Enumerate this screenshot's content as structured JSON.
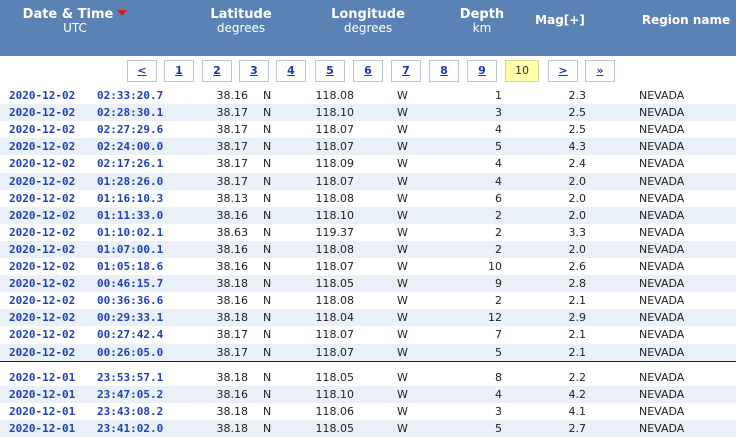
{
  "header": {
    "date_time": "Date & Time",
    "utc": "UTC",
    "latitude": "Latitude",
    "lat_unit": "degrees",
    "longitude": "Longitude",
    "lon_unit": "degrees",
    "depth": "Depth",
    "depth_unit": "km",
    "mag": "Mag[+]",
    "region": "Region name",
    "colors": {
      "header_bg": "#5b82b5",
      "sort_arrow": "#d21c24",
      "link": "#1f3fbf",
      "alt_row": "#e9f0f8",
      "current_page": "#ffffaa"
    }
  },
  "pager": {
    "prev": "<",
    "next": ">",
    "last": "»",
    "pages": [
      "1",
      "2",
      "3",
      "4",
      "5",
      "6",
      "7",
      "8",
      "9",
      "10"
    ],
    "current": "10"
  },
  "rows": [
    {
      "date": "2020-12-02",
      "time": "02:33:20.7",
      "lat": "38.16",
      "ns": "N",
      "lon": "118.08",
      "ew": "W",
      "depth": "1",
      "mag": "2.3",
      "region": "NEVADA"
    },
    {
      "date": "2020-12-02",
      "time": "02:28:30.1",
      "lat": "38.17",
      "ns": "N",
      "lon": "118.10",
      "ew": "W",
      "depth": "3",
      "mag": "2.5",
      "region": "NEVADA"
    },
    {
      "date": "2020-12-02",
      "time": "02:27:29.6",
      "lat": "38.17",
      "ns": "N",
      "lon": "118.07",
      "ew": "W",
      "depth": "4",
      "mag": "2.5",
      "region": "NEVADA"
    },
    {
      "date": "2020-12-02",
      "time": "02:24:00.0",
      "lat": "38.17",
      "ns": "N",
      "lon": "118.07",
      "ew": "W",
      "depth": "5",
      "mag": "4.3",
      "region": "NEVADA"
    },
    {
      "date": "2020-12-02",
      "time": "02:17:26.1",
      "lat": "38.17",
      "ns": "N",
      "lon": "118.09",
      "ew": "W",
      "depth": "4",
      "mag": "2.4",
      "region": "NEVADA"
    },
    {
      "date": "2020-12-02",
      "time": "01:28:26.0",
      "lat": "38.17",
      "ns": "N",
      "lon": "118.07",
      "ew": "W",
      "depth": "4",
      "mag": "2.0",
      "region": "NEVADA"
    },
    {
      "date": "2020-12-02",
      "time": "01:16:10.3",
      "lat": "38.13",
      "ns": "N",
      "lon": "118.08",
      "ew": "W",
      "depth": "6",
      "mag": "2.0",
      "region": "NEVADA"
    },
    {
      "date": "2020-12-02",
      "time": "01:11:33.0",
      "lat": "38.16",
      "ns": "N",
      "lon": "118.10",
      "ew": "W",
      "depth": "2",
      "mag": "2.0",
      "region": "NEVADA"
    },
    {
      "date": "2020-12-02",
      "time": "01:10:02.1",
      "lat": "38.63",
      "ns": "N",
      "lon": "119.37",
      "ew": "W",
      "depth": "2",
      "mag": "3.3",
      "region": "NEVADA"
    },
    {
      "date": "2020-12-02",
      "time": "01:07:00.1",
      "lat": "38.16",
      "ns": "N",
      "lon": "118.08",
      "ew": "W",
      "depth": "2",
      "mag": "2.0",
      "region": "NEVADA"
    },
    {
      "date": "2020-12-02",
      "time": "01:05:18.6",
      "lat": "38.16",
      "ns": "N",
      "lon": "118.07",
      "ew": "W",
      "depth": "10",
      "mag": "2.6",
      "region": "NEVADA"
    },
    {
      "date": "2020-12-02",
      "time": "00:46:15.7",
      "lat": "38.18",
      "ns": "N",
      "lon": "118.05",
      "ew": "W",
      "depth": "9",
      "mag": "2.8",
      "region": "NEVADA"
    },
    {
      "date": "2020-12-02",
      "time": "00:36:36.6",
      "lat": "38.16",
      "ns": "N",
      "lon": "118.08",
      "ew": "W",
      "depth": "2",
      "mag": "2.1",
      "region": "NEVADA"
    },
    {
      "date": "2020-12-02",
      "time": "00:29:33.1",
      "lat": "38.18",
      "ns": "N",
      "lon": "118.04",
      "ew": "W",
      "depth": "12",
      "mag": "2.9",
      "region": "NEVADA"
    },
    {
      "date": "2020-12-02",
      "time": "00:27:42.4",
      "lat": "38.17",
      "ns": "N",
      "lon": "118.07",
      "ew": "W",
      "depth": "7",
      "mag": "2.1",
      "region": "NEVADA"
    },
    {
      "date": "2020-12-02",
      "time": "00:26:05.0",
      "lat": "38.17",
      "ns": "N",
      "lon": "118.07",
      "ew": "W",
      "depth": "5",
      "mag": "2.1",
      "region": "NEVADA"
    },
    {
      "date": "2020-12-01",
      "time": "23:53:57.1",
      "lat": "38.18",
      "ns": "N",
      "lon": "118.05",
      "ew": "W",
      "depth": "8",
      "mag": "2.2",
      "region": "NEVADA"
    },
    {
      "date": "2020-12-01",
      "time": "23:47:05.2",
      "lat": "38.16",
      "ns": "N",
      "lon": "118.10",
      "ew": "W",
      "depth": "4",
      "mag": "4.2",
      "region": "NEVADA"
    },
    {
      "date": "2020-12-01",
      "time": "23:43:08.2",
      "lat": "38.18",
      "ns": "N",
      "lon": "118.06",
      "ew": "W",
      "depth": "3",
      "mag": "4.1",
      "region": "NEVADA"
    },
    {
      "date": "2020-12-01",
      "time": "23:41:02.0",
      "lat": "38.18",
      "ns": "N",
      "lon": "118.05",
      "ew": "W",
      "depth": "5",
      "mag": "2.7",
      "region": "NEVADA"
    }
  ]
}
